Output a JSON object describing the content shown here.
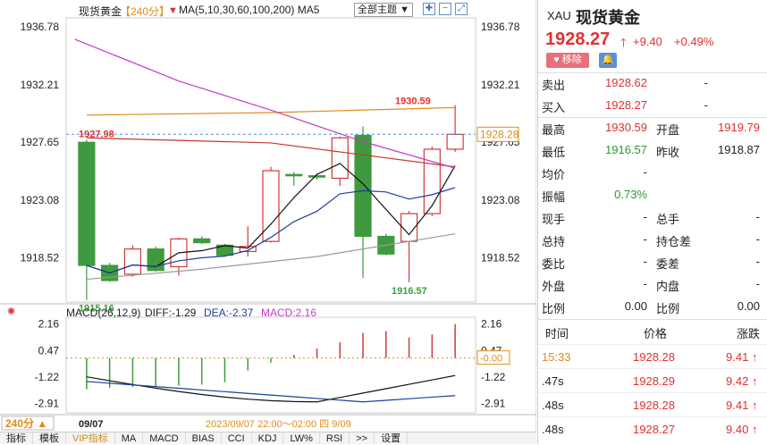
{
  "chart": {
    "title": "现货黄金",
    "period": "【240分】",
    "ma_label": "MA(5,10,30,60,100,200) MA5",
    "theme_dropdown": "全部主题",
    "price_ticks_left": [
      "1936.78",
      "1932.21",
      "1927.65",
      "1923.08",
      "1918.52"
    ],
    "price_ticks_right": [
      "1936.78",
      "1932.21",
      "1927.65",
      "1923.08",
      "1918.52"
    ],
    "current_price_tag": "1928.28",
    "annotation_high": "1930.59",
    "annotation_prev": "1927.98",
    "annotation_low1": "1915.16",
    "annotation_low2": "1916.57",
    "macd_label": "MACD(26,12,9)",
    "diff_label": "DIFF:-1.29",
    "dea_label": "DEA:-2.37",
    "macd_value_label": "MACD:2.16",
    "macd_ticks_left": [
      "2.16",
      "0.47",
      "-1.22",
      "-2.91"
    ],
    "macd_ticks_right": [
      "2.16",
      "0.47",
      "-1.22",
      "-2.91"
    ],
    "macd_zero_tag": "-0.00",
    "period_selector": "240分",
    "date_left": "09/07",
    "date_range": "2023/09/07 22:00～02:00 四 9/09",
    "bottom_tabs": [
      "指标",
      "模板",
      "VIP指标",
      "MA",
      "MACD",
      "BIAS",
      "CCI",
      "KDJ",
      "LW%",
      "RSI",
      ">>",
      "设置"
    ],
    "colors": {
      "up": "#d03a3a",
      "down": "#3f9a3f",
      "ma1": "#111111",
      "ma2": "#1b3f9a",
      "ma3": "#9a9a9a",
      "ma4": "#c0392b",
      "ma5": "#e08c1a",
      "ma6": "#c23ac8"
    }
  },
  "chart_data": {
    "type": "candlestick",
    "candles": [
      {
        "o": 1927.65,
        "h": 1927.85,
        "l": 1915.16,
        "c": 1917.9
      },
      {
        "o": 1917.9,
        "h": 1918.1,
        "l": 1916.6,
        "c": 1916.7
      },
      {
        "o": 1917.2,
        "h": 1919.5,
        "l": 1917.0,
        "c": 1919.2
      },
      {
        "o": 1919.2,
        "h": 1919.4,
        "l": 1917.4,
        "c": 1917.5
      },
      {
        "o": 1917.8,
        "h": 1920.1,
        "l": 1917.1,
        "c": 1920.0
      },
      {
        "o": 1920.0,
        "h": 1920.2,
        "l": 1919.6,
        "c": 1919.7
      },
      {
        "o": 1919.5,
        "h": 1919.6,
        "l": 1918.6,
        "c": 1918.7
      },
      {
        "o": 1919.0,
        "h": 1921.0,
        "l": 1918.6,
        "c": 1919.4
      },
      {
        "o": 1919.8,
        "h": 1925.7,
        "l": 1919.7,
        "c": 1925.4
      },
      {
        "o": 1925.1,
        "h": 1925.3,
        "l": 1924.2,
        "c": 1925.0
      },
      {
        "o": 1925.0,
        "h": 1925.2,
        "l": 1924.7,
        "c": 1924.9
      },
      {
        "o": 1924.8,
        "h": 1928.1,
        "l": 1924.2,
        "c": 1928.0
      },
      {
        "o": 1928.2,
        "h": 1928.9,
        "l": 1916.9,
        "c": 1920.2
      },
      {
        "o": 1920.2,
        "h": 1920.4,
        "l": 1918.7,
        "c": 1918.8
      },
      {
        "o": 1919.8,
        "h": 1922.2,
        "l": 1916.57,
        "c": 1922.0
      },
      {
        "o": 1922.0,
        "h": 1927.3,
        "l": 1921.8,
        "c": 1927.1
      },
      {
        "o": 1927.1,
        "h": 1930.59,
        "l": 1926.9,
        "c": 1928.28
      }
    ],
    "ylim": [
      1915.0,
      1937.5
    ],
    "macd": [
      -2.0,
      -1.9,
      -1.85,
      -1.8,
      -1.75,
      -1.7,
      -1.55,
      -0.8,
      -0.3,
      0.2,
      0.6,
      1.0,
      1.6,
      1.7,
      1.3,
      1.5,
      2.16
    ]
  },
  "quote": {
    "code": "XAU",
    "name": "现货黄金",
    "price": "1928.27",
    "change": "+9.40",
    "change_pct": "+0.49%",
    "remove_label": "移除",
    "sell_label": "卖出",
    "sell_val": "1928.62",
    "sell_dash": "-",
    "buy_label": "买入",
    "buy_val": "1928.27",
    "buy_dash": "-",
    "rows": [
      {
        "l1": "最高",
        "v1": "1930.59",
        "c1": "red",
        "l2": "开盘",
        "v2": "1919.79",
        "c2": "red"
      },
      {
        "l1": "最低",
        "v1": "1916.57",
        "c1": "green",
        "l2": "昨收",
        "v2": "1918.87",
        "c2": "black"
      },
      {
        "l1": "均价",
        "v1": "-",
        "c1": "black",
        "l2": "",
        "v2": "",
        "c2": "black"
      },
      {
        "l1": "振幅",
        "v1": "0.73%",
        "c1": "green",
        "l2": "",
        "v2": "",
        "c2": "black"
      },
      {
        "l1": "现手",
        "v1": "-",
        "c1": "black",
        "l2": "总手",
        "v2": "-",
        "c2": "black"
      },
      {
        "l1": "总持",
        "v1": "-",
        "c1": "black",
        "l2": "持仓差",
        "v2": "-",
        "c2": "black"
      },
      {
        "l1": "委比",
        "v1": "-",
        "c1": "black",
        "l2": "委差",
        "v2": "-",
        "c2": "black"
      },
      {
        "l1": "外盘",
        "v1": "-",
        "c1": "black",
        "l2": "内盘",
        "v2": "-",
        "c2": "black"
      },
      {
        "l1": "比例",
        "v1": "0.00",
        "c1": "black",
        "l2": "比例",
        "v2": "0.00",
        "c2": "black"
      }
    ],
    "ticks_header": {
      "time": "时间",
      "price": "价格",
      "change": "涨跌"
    },
    "ticks": [
      {
        "time": "15:33",
        "price": "1928.28",
        "change": "9.41"
      },
      {
        "time": ".47s",
        "price": "1928.29",
        "change": "9.42"
      },
      {
        "time": ".48s",
        "price": "1928.28",
        "change": "9.41"
      },
      {
        "time": ".48s",
        "price": "1928.27",
        "change": "9.40"
      }
    ]
  }
}
